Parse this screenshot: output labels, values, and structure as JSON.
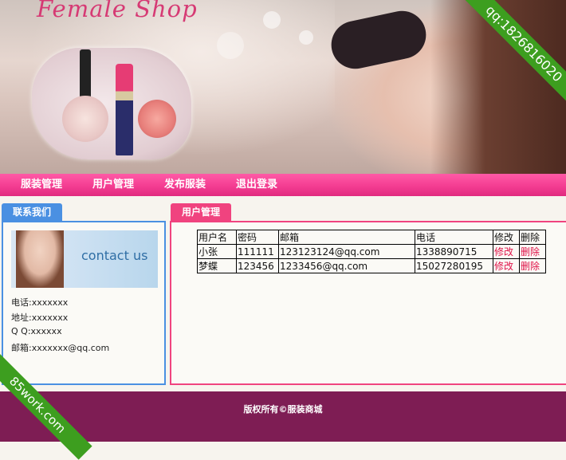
{
  "banner": {
    "shop_title": "Female Shop",
    "corner_ribbon": "qq:1826816020"
  },
  "nav": {
    "items": [
      {
        "label": "服装管理"
      },
      {
        "label": "用户管理"
      },
      {
        "label": "发布服装"
      },
      {
        "label": "退出登录"
      }
    ]
  },
  "contact": {
    "tab_label": "联系我们",
    "image_text": "contact us",
    "phone": "电话:xxxxxxx",
    "address": "地址:xxxxxxx",
    "qq": "Q Q:xxxxxx",
    "email": "邮箱:xxxxxxx@qq.com"
  },
  "user_panel": {
    "tab_label": "用户管理",
    "headers": [
      "用户名",
      "密码",
      "邮箱",
      "电话",
      "修改",
      "删除"
    ],
    "rows": [
      [
        "小张",
        "111111",
        "123123124@qq.com",
        "1338890715",
        "修改",
        "删除"
      ],
      [
        "梦蝶",
        "123456",
        "1233456@qq.com",
        "15027280195",
        "修改",
        "删除"
      ]
    ]
  },
  "footer": {
    "copyright": "版权所有©服装商城"
  },
  "watermark": "85work.com",
  "colors": {
    "nav": "#f43d92",
    "contact_border": "#4a90e2",
    "user_border": "#f0437f",
    "footer": "#7e1d54",
    "ribbon": "#3d9e1f",
    "action_link": "#e0144a"
  }
}
